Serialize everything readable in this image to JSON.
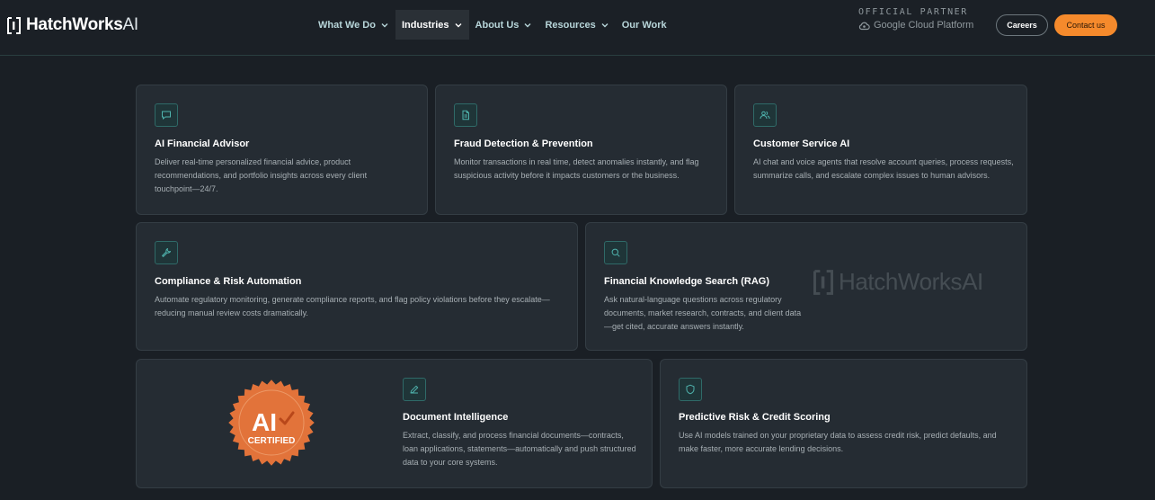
{
  "brand": {
    "name_bold": "HatchWorks",
    "name_light": "AI"
  },
  "nav": {
    "items": [
      {
        "label": "What We Do",
        "has_dropdown": true,
        "active": false
      },
      {
        "label": "Industries",
        "has_dropdown": true,
        "active": true
      },
      {
        "label": "About Us",
        "has_dropdown": true,
        "active": false
      },
      {
        "label": "Resources",
        "has_dropdown": true,
        "active": false
      },
      {
        "label": "Our Work",
        "has_dropdown": false,
        "active": false
      }
    ]
  },
  "partner": {
    "label": "OFFICIAL PARTNER",
    "name": "Google Cloud Platform"
  },
  "header_buttons": {
    "careers": "Careers",
    "contact": "Contact us"
  },
  "colors": {
    "accent": "#f58a2c",
    "teal": "#4fb3ad",
    "background": "#1a1f25",
    "card": "#252c33"
  },
  "cards": [
    {
      "icon": "chat-icon",
      "title": "AI Financial Advisor",
      "description": "Deliver real-time personalized financial advice, product recommendations, and portfolio insights across every client touchpoint—24/7."
    },
    {
      "icon": "document-icon",
      "title": "Fraud Detection & Prevention",
      "description": "Monitor transactions in real time, detect anomalies instantly, and flag suspicious activity before it impacts customers or the business."
    },
    {
      "icon": "users-icon",
      "title": "Customer Service AI",
      "description": "AI chat and voice agents that resolve account queries, process requests, summarize calls, and escalate complex issues to human advisors."
    },
    {
      "icon": "wrench-icon",
      "title": "Compliance & Risk Automation",
      "description": "Automate regulatory monitoring, generate compliance reports, and flag policy violations before they escalate—reducing manual review costs dramatically."
    },
    {
      "icon": "search-icon",
      "title": "Financial Knowledge Search (RAG)",
      "description": "Ask natural-language questions across regulatory documents, market research, contracts, and client data—get cited, accurate answers instantly."
    },
    {
      "icon": "pen-icon",
      "title": "Document Intelligence",
      "description": "Extract, classify, and process financial documents—contracts, loan applications, statements—automatically and push structured data to your core systems."
    },
    {
      "icon": "shield-icon",
      "title": "Predictive Risk & Credit Scoring",
      "description": "Use AI models trained on your proprietary data to assess credit risk, predict defaults, and make faster, more accurate lending decisions."
    }
  ],
  "watermark": {
    "name_bold": "HatchWorks",
    "name_light": "AI"
  },
  "badge": {
    "line1": "AI",
    "line2": "CERTIFIED"
  }
}
